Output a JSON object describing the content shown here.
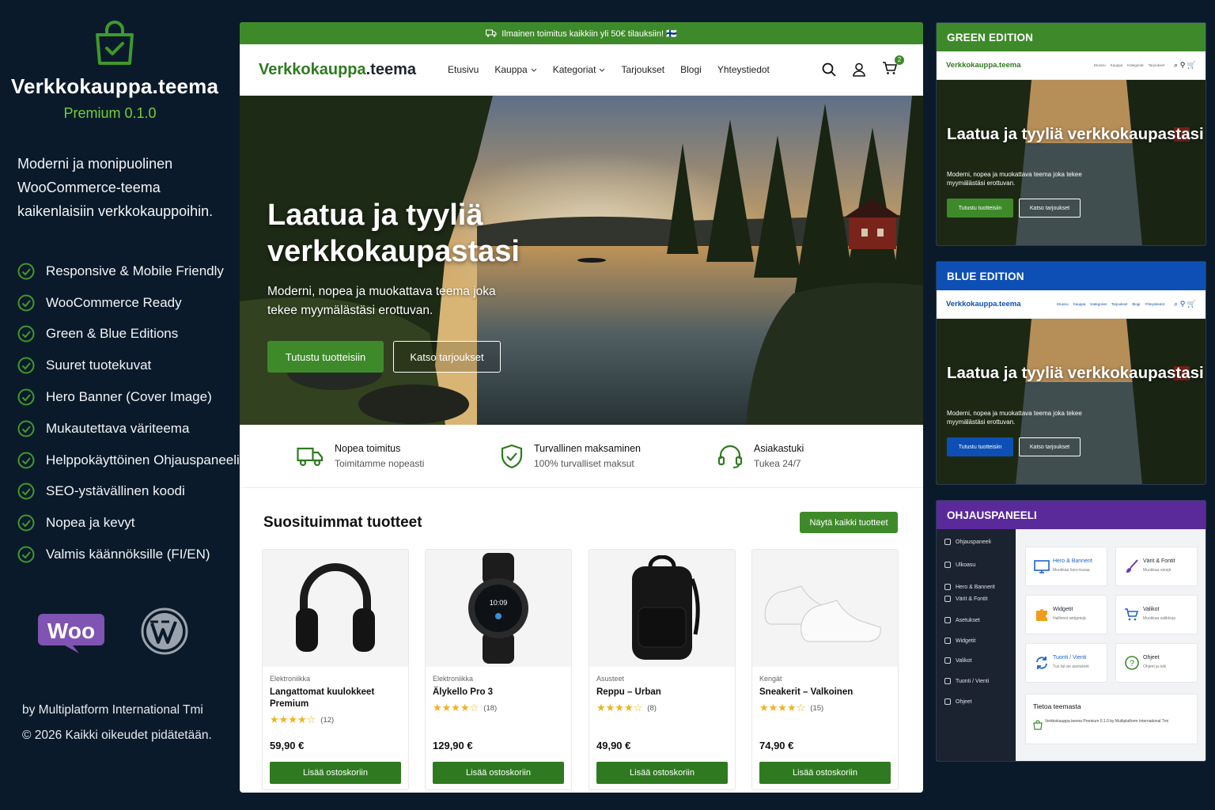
{
  "left": {
    "brand": "Verkkokauppa.teema",
    "version": "Premium 0.1.0",
    "tagline": "Moderni ja monipuolinen WooCommerce-teema kaikenlaisiin verkkokauppoihin.",
    "features": [
      "Responsive & Mobile Friendly",
      "WooCommerce Ready",
      "Green & Blue Editions",
      "Suuret tuotekuvat",
      "Hero Banner (Cover Image)",
      "Mukautettava väriteema",
      "Helppokäyttöinen Ohjauspaneeli",
      "SEO-ystävällinen koodi",
      "Nopea ja kevyt",
      "Valmis käännöksille (FI/EN)"
    ],
    "woo_logo": "Woo",
    "credit_line1": "by Multiplatform International Tmi",
    "credit_line2": "© 2026 Kaikki oikeudet pidätetään."
  },
  "shop": {
    "topbar": "Ilmainen toimitus kaikkiin yli 50€ tilauksiin! 🇫🇮",
    "logo_green": "Verkkokauppa",
    "logo_dark": ".teema",
    "menu": [
      "Etusivu",
      "Kauppa",
      "Kategoriat",
      "Tarjoukset",
      "Blogi",
      "Yhteystiedot"
    ],
    "cart_count": "2",
    "hero_title": "Laatua ja tyyliä verkkokaupastasi",
    "hero_sub": "Moderni, nopea ja muokattava teema joka tekee myymälästäsi erottuvan.",
    "hero_btn_primary": "Tutustu tuotteisiin",
    "hero_btn_secondary": "Katso tarjoukset",
    "usps": [
      {
        "title": "Nopea toimitus",
        "sub": "Toimitamme nopeasti",
        "icon": "truck-icon"
      },
      {
        "title": "Turvallinen maksaminen",
        "sub": "100% turvalliset maksut",
        "icon": "shield-icon"
      },
      {
        "title": "Asiakastuki",
        "sub": "Tukea 24/7",
        "icon": "headset-icon"
      }
    ],
    "products_title": "Suosituimmat tuotteet",
    "all_products_btn": "Näytä kaikki tuotteet",
    "products": [
      {
        "category": "Elektroniikka",
        "name": "Langattomat kuulokkeet Premium",
        "rating": 4.5,
        "reviews": "(12)",
        "price": "59,90 €",
        "add": "Lisää ostoskoriin"
      },
      {
        "category": "Elektroniikka",
        "name": "Älykello Pro 3",
        "rating": 4.5,
        "reviews": "(18)",
        "price": "129,90 €",
        "add": "Lisää ostoskoriin"
      },
      {
        "category": "Asusteet",
        "name": "Reppu – Urban",
        "rating": 4.5,
        "reviews": "(8)",
        "price": "49,90 €",
        "add": "Lisää ostoskoriin"
      },
      {
        "category": "Kengät",
        "name": "Sneakerit – Valkoinen",
        "rating": 4.5,
        "reviews": "(15)",
        "price": "74,90 €",
        "add": "Lisää ostoskoriin"
      }
    ]
  },
  "green_edition": {
    "header": "GREEN EDITION",
    "logo": "Verkkokauppa.teema",
    "hero_title": "Laatua ja tyyliä verkkokaupastasi",
    "hero_sub": "Moderni, nopea ja muokattava teema joka tekee myymälästäsi erottuvan.",
    "btn1": "Tutustu tuotteisiin",
    "btn2": "Katso tarjoukset",
    "accent": "#3e8a2a"
  },
  "blue_edition": {
    "header": "BLUE EDITION",
    "logo": "Verkkokauppa.teema",
    "hero_title": "Laatua ja tyyliä verkkokaupastasi",
    "hero_sub": "Moderni, nopea ja muokattava teema joka tekee myymälästäsi erottuvan.",
    "btn1": "Tutustu tuotteisiin",
    "btn2": "Katso tarjoukset",
    "accent": "#0d4fb5"
  },
  "dashboard": {
    "header": "OHJAUSPANEELI",
    "sidebar": [
      "Ohjauspaneeli",
      "Ulkoasu",
      "Hero & Bannerit",
      "Värit & Fontit",
      "Asetukset",
      "Widgetit",
      "Valikot",
      "Tuonti / Vienti",
      "Ohjeet"
    ],
    "tiles": [
      {
        "title": "Hero & Bannerit",
        "sub": "Muokkaa hero-kuvaa"
      },
      {
        "title": "Värit & Fontit",
        "sub": "Muokkaa värejä"
      },
      {
        "title": "Widgetit",
        "sub": "Hallinnoi widgetejä"
      },
      {
        "title": "Valikot",
        "sub": "Muokkaa valikkoja"
      },
      {
        "title": "Tuonti / Vienti",
        "sub": "Tuo tai vie asetukset"
      },
      {
        "title": "Ohjeet",
        "sub": "Ohjeet ja tuki"
      }
    ],
    "about_title": "Tietoa teemasta",
    "about_body": "Verkkokauppa.teema Premium 0.1.0 by Multiplatform International Tmi"
  },
  "colors": {
    "background": "#0b1a2a",
    "green": "#3e8a2a",
    "blue": "#0d4fb5",
    "purple": "#5a2a9a"
  }
}
